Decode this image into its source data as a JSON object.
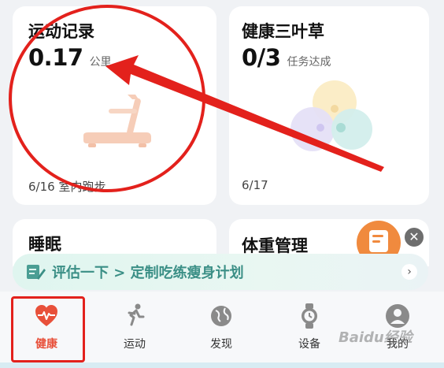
{
  "cards": {
    "exercise": {
      "title": "运动记录",
      "value": "0.17",
      "unit": "公里",
      "footer": "6/16 室内跑步",
      "icon": "treadmill-icon"
    },
    "clover": {
      "title": "健康三叶草",
      "value": "0/3",
      "unit": "任务达成",
      "footer": "6/17",
      "icon": "clover-icon"
    },
    "sleep": {
      "title": "睡眠"
    },
    "weight": {
      "title": "体重管理",
      "icon": "clipboard-icon"
    }
  },
  "banner": {
    "text": "评估一下 > 定制吃练瘦身计划",
    "icon": "edit-note-icon",
    "chevron": "›"
  },
  "close_symbol": "✕",
  "nav": {
    "items": [
      {
        "label": "健康",
        "icon": "heart-pulse-icon",
        "active": true
      },
      {
        "label": "运动",
        "icon": "running-icon",
        "active": false
      },
      {
        "label": "发现",
        "icon": "globe-icon",
        "active": false
      },
      {
        "label": "设备",
        "icon": "watch-icon",
        "active": false
      },
      {
        "label": "我的",
        "icon": "profile-icon",
        "active": false
      }
    ]
  },
  "watermark": "Baidu经验",
  "colors": {
    "accent_red": "#e3211c",
    "active_nav": "#e8503a",
    "banner_text": "#3b8f86",
    "weight_orange": "#f08a3e"
  }
}
